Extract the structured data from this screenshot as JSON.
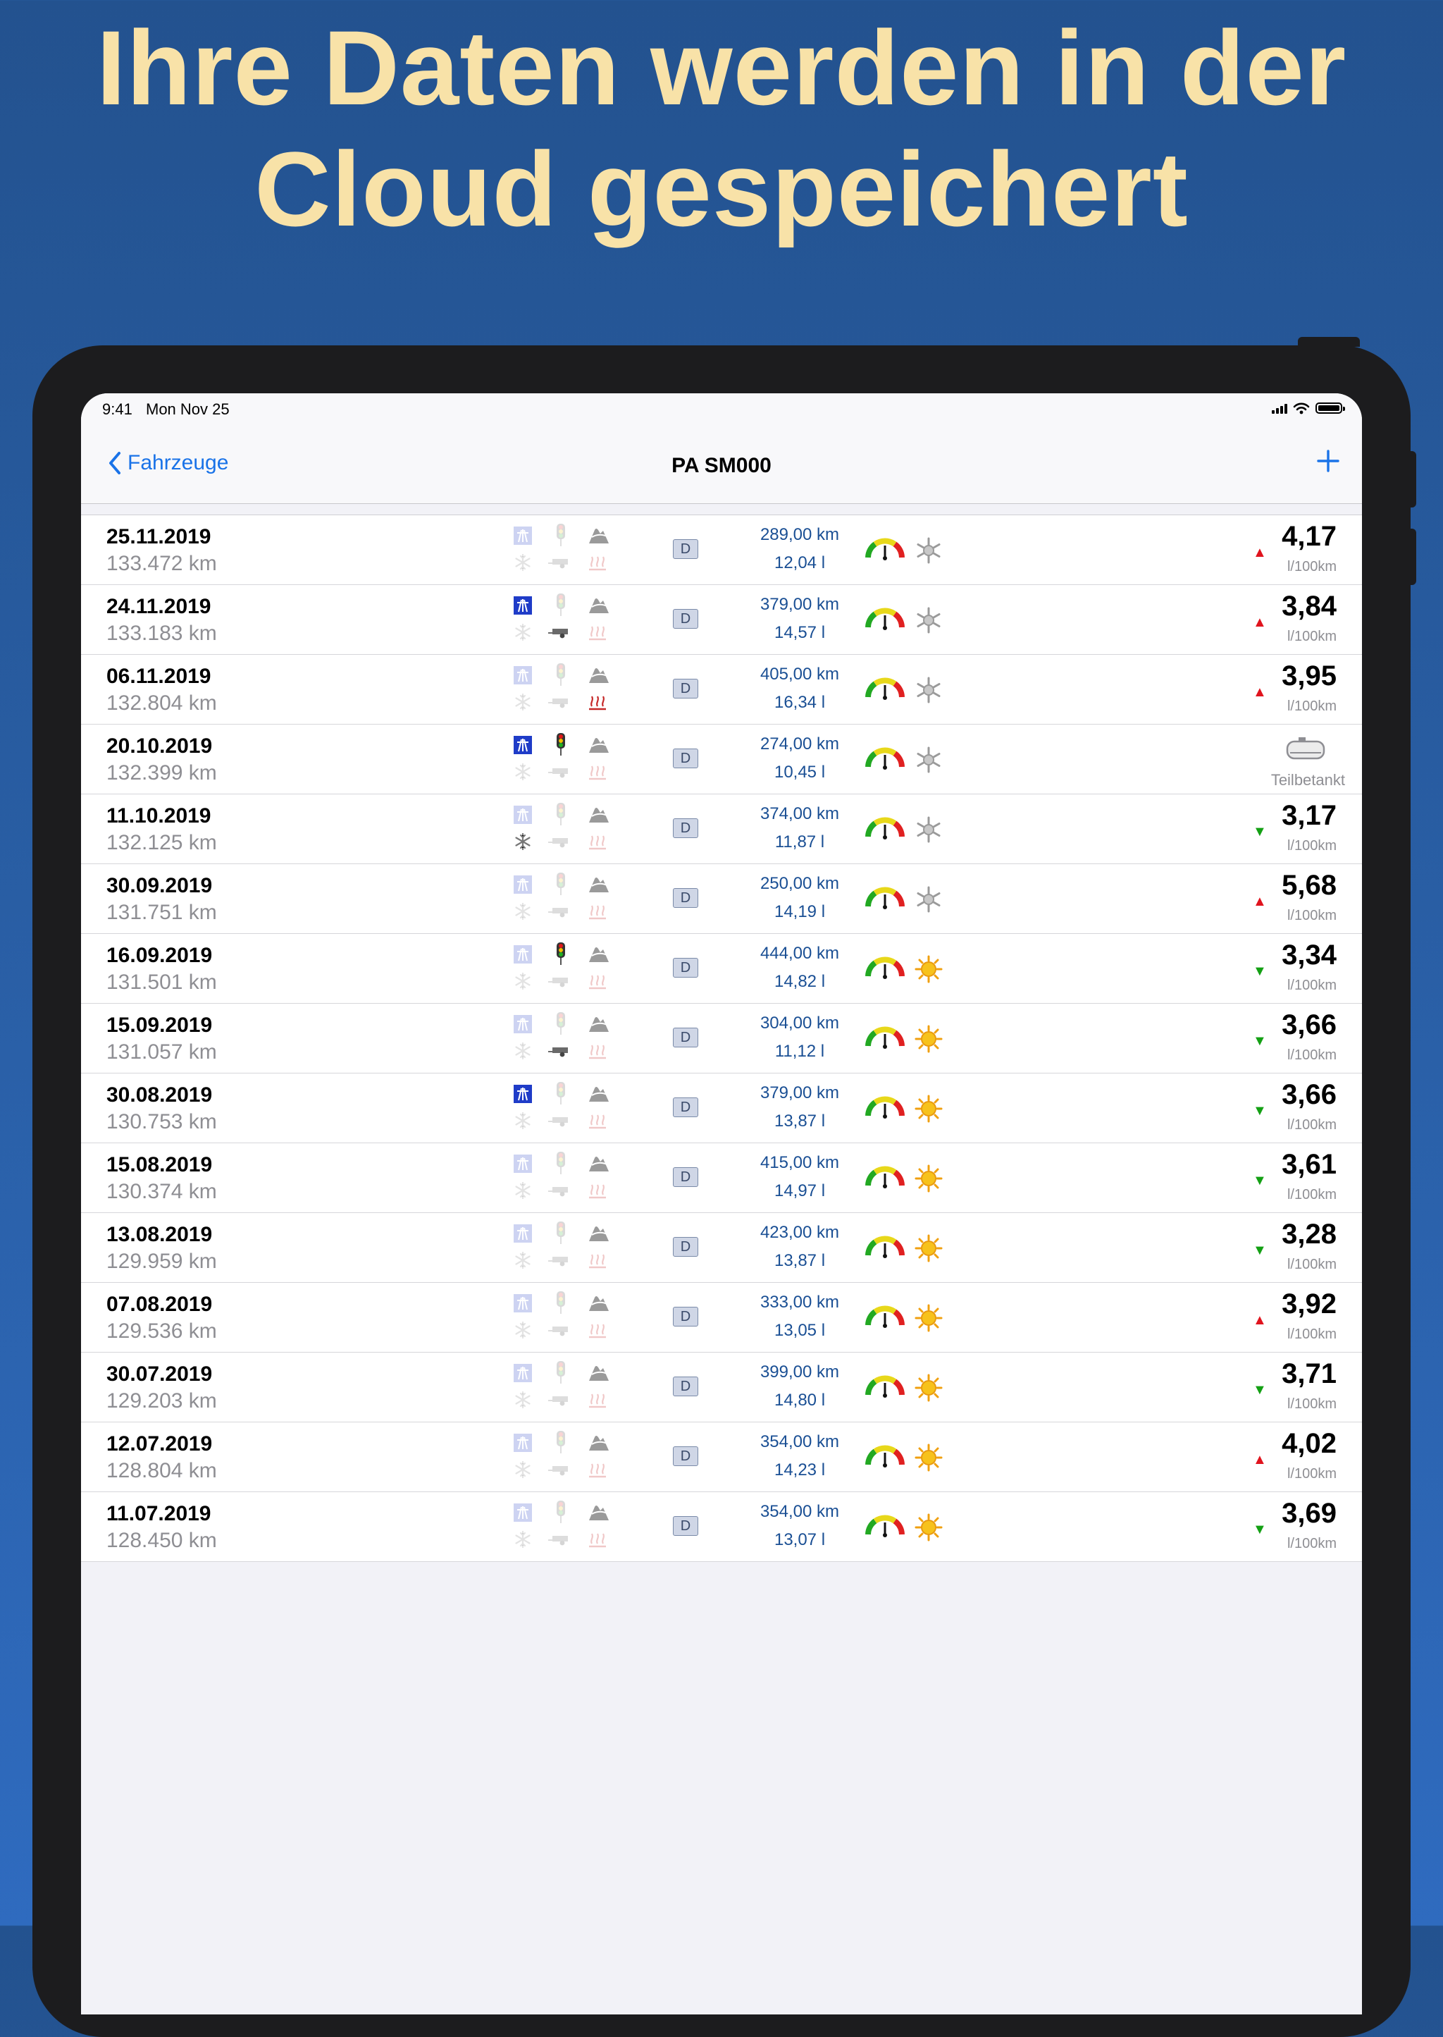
{
  "headline": {
    "line1": "Ihre Daten werden in der",
    "line2": "Cloud gespeichert"
  },
  "status_bar": {
    "time": "9:41",
    "date": "Mon Nov 25"
  },
  "nav": {
    "back_label": "Fahrzeuge",
    "title": "PA SM000",
    "add_icon": "plus-icon"
  },
  "colors": {
    "accent": "#1a73e8",
    "headline": "#f8e2a8",
    "trend_up": "#e0141e",
    "trend_down": "#14a014",
    "distance_text": "#1a4f94"
  },
  "entries": [
    {
      "date": "25.11.2019",
      "odometer": "133.472 km",
      "fuel_type": "D",
      "distance": "289,00 km",
      "volume": "12,04 l",
      "weather": "cold",
      "trend": "up",
      "consumption": "4,17",
      "unit": "l/100km",
      "partial": false,
      "partial_label": "",
      "highway": false,
      "traffic_light": false,
      "mountain": true,
      "snow": false,
      "trailer": false,
      "heating": false
    },
    {
      "date": "24.11.2019",
      "odometer": "133.183 km",
      "fuel_type": "D",
      "distance": "379,00 km",
      "volume": "14,57 l",
      "weather": "cold",
      "trend": "up",
      "consumption": "3,84",
      "unit": "l/100km",
      "partial": false,
      "partial_label": "",
      "highway": true,
      "traffic_light": false,
      "mountain": true,
      "snow": false,
      "trailer": true,
      "heating": false
    },
    {
      "date": "06.11.2019",
      "odometer": "132.804 km",
      "fuel_type": "D",
      "distance": "405,00 km",
      "volume": "16,34 l",
      "weather": "cold",
      "trend": "up",
      "consumption": "3,95",
      "unit": "l/100km",
      "partial": false,
      "partial_label": "",
      "highway": false,
      "traffic_light": false,
      "mountain": true,
      "snow": false,
      "trailer": false,
      "heating": true
    },
    {
      "date": "20.10.2019",
      "odometer": "132.399 km",
      "fuel_type": "D",
      "distance": "274,00 km",
      "volume": "10,45 l",
      "weather": "cold",
      "trend": "",
      "consumption": "",
      "unit": "",
      "partial": true,
      "partial_label": "Teilbetankt",
      "highway": true,
      "traffic_light": true,
      "mountain": true,
      "snow": false,
      "trailer": false,
      "heating": false
    },
    {
      "date": "11.10.2019",
      "odometer": "132.125 km",
      "fuel_type": "D",
      "distance": "374,00 km",
      "volume": "11,87 l",
      "weather": "cold",
      "trend": "down",
      "consumption": "3,17",
      "unit": "l/100km",
      "partial": false,
      "partial_label": "",
      "highway": false,
      "traffic_light": false,
      "mountain": true,
      "snow": true,
      "trailer": false,
      "heating": false
    },
    {
      "date": "30.09.2019",
      "odometer": "131.751 km",
      "fuel_type": "D",
      "distance": "250,00 km",
      "volume": "14,19 l",
      "weather": "cold",
      "trend": "up",
      "consumption": "5,68",
      "unit": "l/100km",
      "partial": false,
      "partial_label": "",
      "highway": false,
      "traffic_light": false,
      "mountain": true,
      "snow": false,
      "trailer": false,
      "heating": false
    },
    {
      "date": "16.09.2019",
      "odometer": "131.501 km",
      "fuel_type": "D",
      "distance": "444,00 km",
      "volume": "14,82 l",
      "weather": "sun",
      "trend": "down",
      "consumption": "3,34",
      "unit": "l/100km",
      "partial": false,
      "partial_label": "",
      "highway": false,
      "traffic_light": true,
      "mountain": true,
      "snow": false,
      "trailer": false,
      "heating": false
    },
    {
      "date": "15.09.2019",
      "odometer": "131.057 km",
      "fuel_type": "D",
      "distance": "304,00 km",
      "volume": "11,12 l",
      "weather": "sun",
      "trend": "down",
      "consumption": "3,66",
      "unit": "l/100km",
      "partial": false,
      "partial_label": "",
      "highway": false,
      "traffic_light": false,
      "mountain": true,
      "snow": false,
      "trailer": true,
      "heating": false
    },
    {
      "date": "30.08.2019",
      "odometer": "130.753 km",
      "fuel_type": "D",
      "distance": "379,00 km",
      "volume": "13,87 l",
      "weather": "sun",
      "trend": "down",
      "consumption": "3,66",
      "unit": "l/100km",
      "partial": false,
      "partial_label": "",
      "highway": true,
      "traffic_light": false,
      "mountain": true,
      "snow": false,
      "trailer": false,
      "heating": false
    },
    {
      "date": "15.08.2019",
      "odometer": "130.374 km",
      "fuel_type": "D",
      "distance": "415,00 km",
      "volume": "14,97 l",
      "weather": "sun",
      "trend": "down",
      "consumption": "3,61",
      "unit": "l/100km",
      "partial": false,
      "partial_label": "",
      "highway": false,
      "traffic_light": false,
      "mountain": true,
      "snow": false,
      "trailer": false,
      "heating": false
    },
    {
      "date": "13.08.2019",
      "odometer": "129.959 km",
      "fuel_type": "D",
      "distance": "423,00 km",
      "volume": "13,87 l",
      "weather": "sun",
      "trend": "down",
      "consumption": "3,28",
      "unit": "l/100km",
      "partial": false,
      "partial_label": "",
      "highway": false,
      "traffic_light": false,
      "mountain": true,
      "snow": false,
      "trailer": false,
      "heating": false
    },
    {
      "date": "07.08.2019",
      "odometer": "129.536 km",
      "fuel_type": "D",
      "distance": "333,00 km",
      "volume": "13,05 l",
      "weather": "sun",
      "trend": "up",
      "consumption": "3,92",
      "unit": "l/100km",
      "partial": false,
      "partial_label": "",
      "highway": false,
      "traffic_light": false,
      "mountain": true,
      "snow": false,
      "trailer": false,
      "heating": false
    },
    {
      "date": "30.07.2019",
      "odometer": "129.203 km",
      "fuel_type": "D",
      "distance": "399,00 km",
      "volume": "14,80 l",
      "weather": "sun",
      "trend": "down",
      "consumption": "3,71",
      "unit": "l/100km",
      "partial": false,
      "partial_label": "",
      "highway": false,
      "traffic_light": false,
      "mountain": true,
      "snow": false,
      "trailer": false,
      "heating": false
    },
    {
      "date": "12.07.2019",
      "odometer": "128.804 km",
      "fuel_type": "D",
      "distance": "354,00 km",
      "volume": "14,23 l",
      "weather": "sun",
      "trend": "up",
      "consumption": "4,02",
      "unit": "l/100km",
      "partial": false,
      "partial_label": "",
      "highway": false,
      "traffic_light": false,
      "mountain": true,
      "snow": false,
      "trailer": false,
      "heating": false
    },
    {
      "date": "11.07.2019",
      "odometer": "128.450 km",
      "fuel_type": "D",
      "distance": "354,00 km",
      "volume": "13,07 l",
      "weather": "sun",
      "trend": "down",
      "consumption": "3,69",
      "unit": "l/100km",
      "partial": false,
      "partial_label": "",
      "highway": false,
      "traffic_light": false,
      "mountain": true,
      "snow": false,
      "trailer": false,
      "heating": false
    }
  ]
}
